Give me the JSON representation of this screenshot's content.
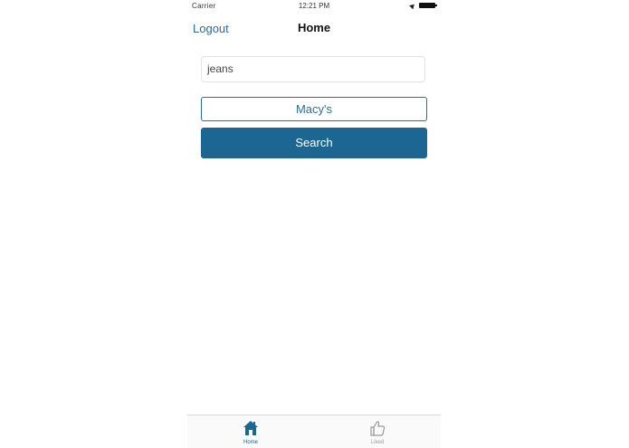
{
  "status_bar": {
    "carrier": "Carrier",
    "time": "12:21 PM"
  },
  "nav": {
    "left_label": "Logout",
    "title": "Home"
  },
  "search": {
    "value": "jeans"
  },
  "store_button": {
    "label": "Macy's"
  },
  "search_button": {
    "label": "Search"
  },
  "tab_bar": {
    "tabs": [
      {
        "label": "Home",
        "icon": "home-icon",
        "active": true
      },
      {
        "label": "Liked",
        "icon": "thumbs-up-icon",
        "active": false
      }
    ]
  },
  "colors": {
    "accent": "#1c6694",
    "link": "#1f6fa0",
    "inactive": "#999999"
  }
}
